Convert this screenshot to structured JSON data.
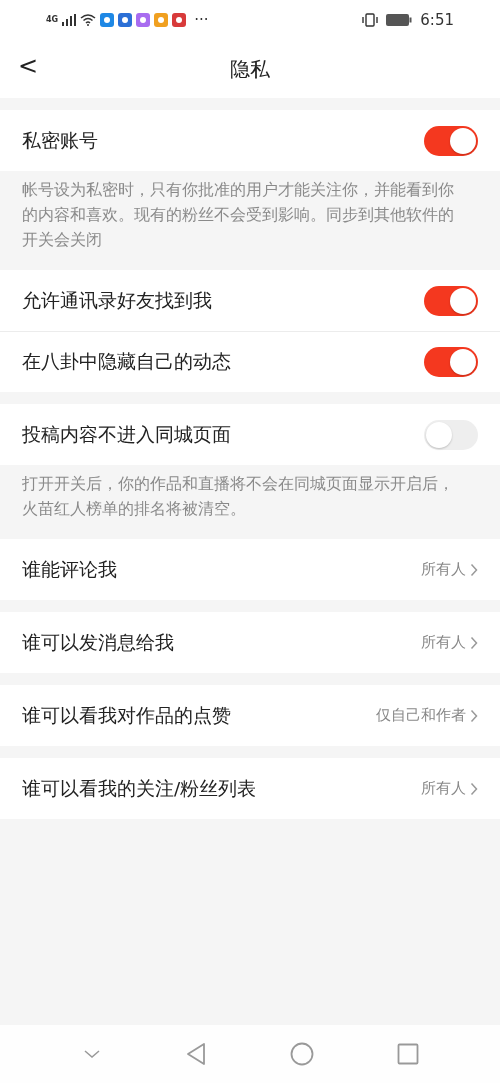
{
  "status_bar": {
    "network": "4G",
    "time": "6:51",
    "more": "···"
  },
  "header": {
    "back": "<",
    "title": "隐私"
  },
  "sections": [
    {
      "rows": [
        {
          "kind": "toggle",
          "label": "私密账号",
          "on": true
        }
      ],
      "note": "帐号设为私密时，只有你批准的用户才能关注你，并能看到你的内容和喜欢。现有的粉丝不会受到影响。同步到其他软件的开关会关闭"
    },
    {
      "rows": [
        {
          "kind": "toggle",
          "label": "允许通讯录好友找到我",
          "on": true
        },
        {
          "kind": "toggle",
          "label": "在八卦中隐藏自己的动态",
          "on": true
        }
      ]
    },
    {
      "rows": [
        {
          "kind": "toggle",
          "label": "投稿内容不进入同城页面",
          "on": false
        }
      ],
      "note": "打开开关后，你的作品和直播将不会在同城页面显示开启后，火苗红人榜单的排名将被清空。"
    },
    {
      "rows": [
        {
          "kind": "link",
          "label": "谁能评论我",
          "value": "所有人"
        }
      ]
    },
    {
      "rows": [
        {
          "kind": "link",
          "label": "谁可以发消息给我",
          "value": "所有人"
        }
      ]
    },
    {
      "rows": [
        {
          "kind": "link",
          "label": "谁可以看我对作品的点赞",
          "value": "仅自己和作者"
        }
      ]
    },
    {
      "rows": [
        {
          "kind": "link",
          "label": "谁可以看我的关注/粉丝列表",
          "value": "所有人"
        }
      ]
    }
  ]
}
